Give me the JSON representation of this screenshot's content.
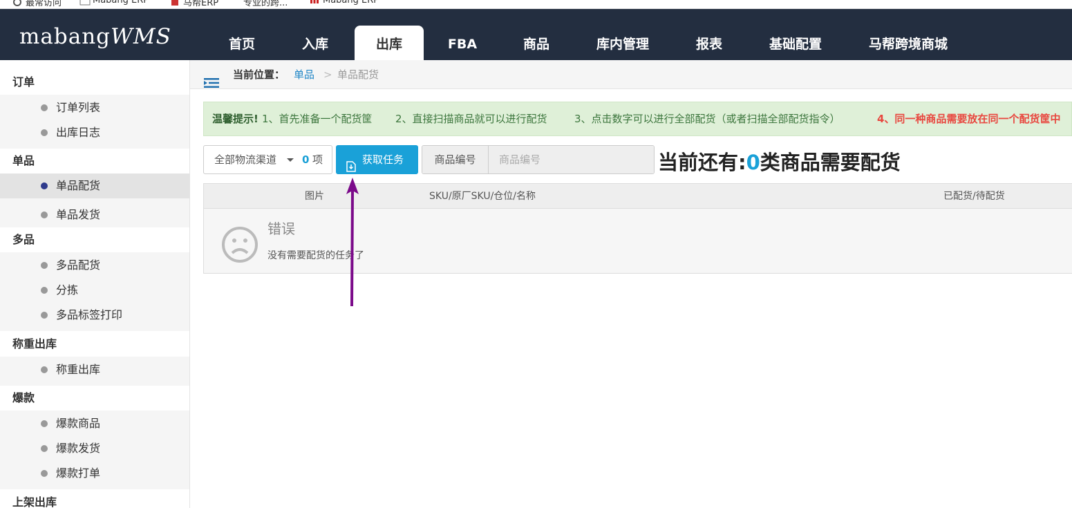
{
  "bookmarks": [
    {
      "label": "最常访问",
      "icon": "gear-icon"
    },
    {
      "label": "Mabang ERP",
      "icon": "image-icon"
    },
    {
      "label": "马帮ERP",
      "icon": "link-icon"
    },
    {
      "label": "专业的跨...",
      "icon": "link-icon"
    },
    {
      "label": "Mabang ERP",
      "icon": "grid-icon"
    }
  ],
  "logo": {
    "main": "mabang",
    "suffix": "WMS"
  },
  "nav": [
    "首页",
    "入库",
    "出库",
    "FBA",
    "商品",
    "库内管理",
    "报表",
    "基础配置",
    "马帮跨境商城"
  ],
  "sidebar": {
    "groups": [
      {
        "title": "订单",
        "items": [
          "订单列表",
          "出库日志"
        ]
      },
      {
        "title": "单品",
        "items": [
          "单品配货",
          "单品发货"
        ]
      },
      {
        "title": "多品",
        "items": [
          "多品配货",
          "分拣",
          "多品标签打印"
        ]
      },
      {
        "title": "称重出库",
        "items": [
          "称重出库"
        ]
      },
      {
        "title": "爆款",
        "items": [
          "爆款商品",
          "爆款发货",
          "爆款打单"
        ]
      },
      {
        "title": "上架出库",
        "items": []
      }
    ]
  },
  "breadcrumb": {
    "label": "当前位置：",
    "link": "单品",
    "separator": ">",
    "current": "单品配货"
  },
  "tip": {
    "prefix": "温馨提示!",
    "step1": "1、首先准备一个配货筐",
    "step2": "2、直接扫描商品就可以进行配货",
    "step3": "3、点击数字可以进行全部配货（或者扫描全部配货指令）",
    "step4": "4、同一种商品需要放在同一个配货筐中"
  },
  "toolbar": {
    "channel_label": "全部物流渠道",
    "channel_count": "0",
    "channel_unit": "项",
    "fetch_label": "获取任务",
    "sku_addon": "商品编号",
    "sku_placeholder": "商品编号"
  },
  "remaining": {
    "prefix": "当前还有:",
    "count": "0",
    "suffix": "类商品需要配货"
  },
  "table": {
    "headers": [
      "图片",
      "SKU/原厂SKU/仓位/名称",
      "已配货/待配货"
    ],
    "error_title": "错误",
    "error_message": "没有需要配货的任务了"
  },
  "colors": {
    "nav_bg": "#232e40",
    "accent": "#1aa1d8",
    "tip_bg": "#dff0d8",
    "warning": "#e8473f",
    "arrow": "#7b0a8a"
  }
}
